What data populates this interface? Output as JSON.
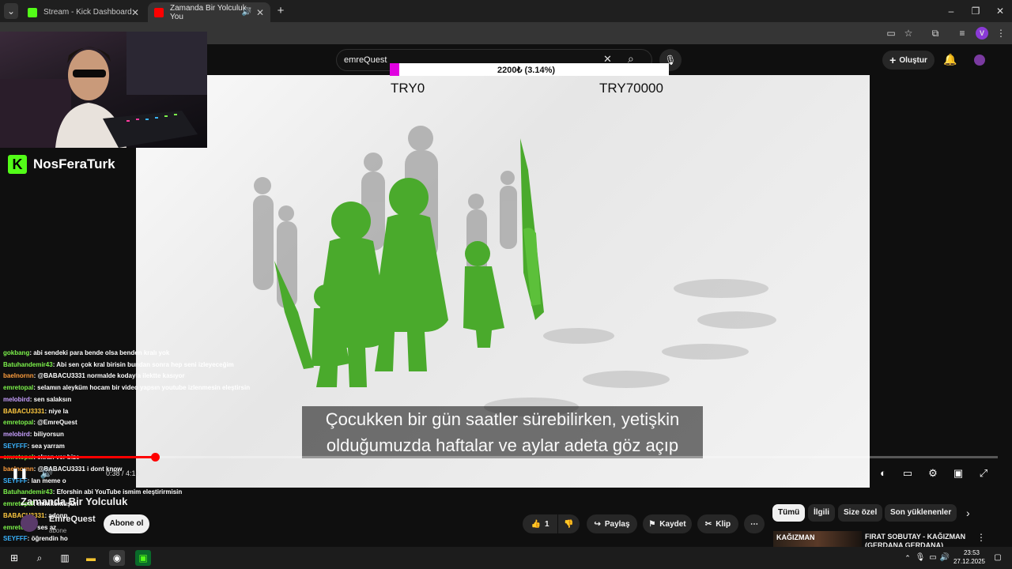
{
  "browser": {
    "tabs": [
      {
        "label": "Stream - Kick Dashboard",
        "fav_color": "#53fc18",
        "active": false
      },
      {
        "label": "Zamanda Bir Yolculuk - You",
        "fav_color": "#ff0000",
        "active": true
      }
    ],
    "new_tab": "+",
    "window_controls": {
      "minimize": "–",
      "restore": "❐",
      "close": "✕"
    }
  },
  "youtube": {
    "search_value": "emreQuest",
    "create_label": "Oluştur",
    "captions": [
      "Çocukken bir gün saatler sürebilirken, yetişkin",
      "olduğumuzda haftalar ve aylar adeta göz açıp"
    ],
    "timecode": "0:38 / 4:16",
    "progress_fraction": 0.155,
    "video_title": "Zamanda Bir Yolculuk",
    "channel_name": "EmreQuest",
    "channel_subs": "abone",
    "subscribe_label": "Abone ol",
    "like_count": "1",
    "share_label": "Paylaş",
    "save_label": "Kaydet",
    "clip_label": "Klip",
    "more_label": "⋯",
    "chips": [
      "Tümü",
      "İlgili",
      "Size özel",
      "Son yüklenenler"
    ],
    "recommended": {
      "title": "FIRAT SOBUTAY - KAĞIZMAN (GERDANA GERDANA)",
      "thumb_text": "KAĞIZMAN"
    }
  },
  "donation_goal": {
    "progress": "2200₺ (3.14%)",
    "fraction": 0.0314,
    "min_label": "TRY0",
    "max_label": "TRY70000",
    "fill_color": "#e000e0"
  },
  "stream": {
    "brand_logo": "K",
    "brand_name": "NosFeraTurk",
    "chat": [
      {
        "user": "gokbang",
        "color": "#7cf24b",
        "text": "abi sendeki para bende olsa benden kralı yok"
      },
      {
        "user": "Batuhandemir43",
        "color": "#7cf24b",
        "text": "Abi sen çok kral birisin bundan sonra hep seni izleyeceğim"
      },
      {
        "user": "baelnornn",
        "color": "#ff9e3d",
        "text": "@BABACU3331 normalde kodayla ilektte kasıyor"
      },
      {
        "user": "emretopal",
        "color": "#7cf24b",
        "text": "selamın aleyküm hocam bir video yapsın youtube izlenmesin eleştirsin"
      },
      {
        "user": "melobird",
        "color": "#c8a0ff",
        "text": "sen salaksın"
      },
      {
        "user": "BABACU3331",
        "color": "#ffc940",
        "text": "niye la"
      },
      {
        "user": "emretopal",
        "color": "#7cf24b",
        "text": "@EmreQuest"
      },
      {
        "user": "melobird",
        "color": "#c8a0ff",
        "text": "biliyorsun"
      },
      {
        "user": "SEYFFF",
        "color": "#3ab4ff",
        "text": "sea yarram"
      },
      {
        "user": "emretopal",
        "color": "#7cf24b",
        "text": "ekran ver bize"
      },
      {
        "user": "baelnornn",
        "color": "#ff9e3d",
        "text": "@BABACU3331 i dont know"
      },
      {
        "user": "SEYFFF",
        "color": "#3ab4ff",
        "text": "lan meme o"
      },
      {
        "user": "Batuhandemir43",
        "color": "#7cf24b",
        "text": "Eforshin abi YouTube ismim eleştirirmisin"
      },
      {
        "user": "emretopal",
        "color": "#7cf24b",
        "text": "minikoktuşun"
      },
      {
        "user": "BABACU3331",
        "color": "#ffc940",
        "text": "adonp"
      },
      {
        "user": "emretopal",
        "color": "#7cf24b",
        "text": "ses az"
      },
      {
        "user": "SEYFFF",
        "color": "#3ab4ff",
        "text": "öğrendin ho"
      }
    ]
  },
  "taskbar": {
    "time": "23:53",
    "date": "27.12.2025"
  },
  "colors": {
    "accent_red": "#ff0000",
    "kick_green": "#53fc18"
  }
}
